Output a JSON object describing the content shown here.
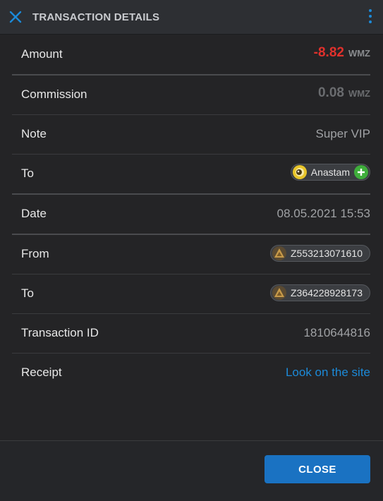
{
  "header": {
    "title": "TRANSACTION DETAILS",
    "close_icon": "close-icon",
    "menu_icon": "kebab-menu-icon",
    "accent_color": "#1c8ad8"
  },
  "rows": {
    "amount": {
      "label": "Amount",
      "value": "-8.82",
      "unit": "WMZ",
      "color": "#e0312c"
    },
    "commission": {
      "label": "Commission",
      "value": "0.08",
      "unit": "WMZ"
    },
    "note": {
      "label": "Note",
      "value": "Super VIP"
    },
    "to_user": {
      "label": "To",
      "name": "Anastam",
      "avatar_icon": "user-avatar-icon",
      "add_icon": "plus-circle-icon"
    },
    "date": {
      "label": "Date",
      "value": "08.05.2021 15:53"
    },
    "from": {
      "label": "From",
      "purse": "Z553213071610",
      "icon": "wallet-purse-icon"
    },
    "to_purse": {
      "label": "To",
      "purse": "Z364228928173",
      "icon": "wallet-purse-icon"
    },
    "transaction_id": {
      "label": "Transaction ID",
      "value": "1810644816"
    },
    "receipt": {
      "label": "Receipt",
      "link": "Look on the site"
    }
  },
  "footer": {
    "close_label": "CLOSE",
    "button_color": "#1a72c2"
  }
}
